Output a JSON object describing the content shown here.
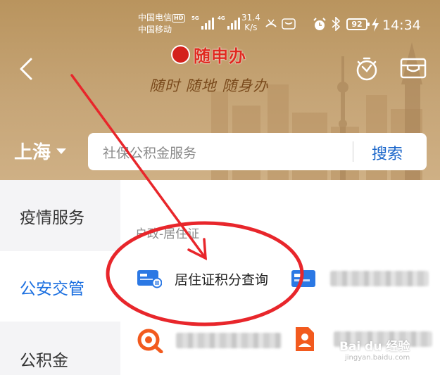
{
  "status_bar": {
    "carrier_1": "中国电信",
    "hd_badge": "HD",
    "carrier_2": "中国移动",
    "signal_1_tag": "5G",
    "signal_2_tag": "4G",
    "net_speed_value": "31.4",
    "net_speed_unit": "K/s",
    "battery": "92",
    "time": "14:34"
  },
  "header": {
    "app_title": "随申办",
    "slogan": "随时 随地 随身办",
    "city": "上海",
    "search": {
      "placeholder": "社保公积金服务",
      "button_label": "搜索"
    }
  },
  "sidebar": {
    "items": [
      {
        "label": "疫情服务",
        "active": false
      },
      {
        "label": "公安交管",
        "active": true
      },
      {
        "label": "公积金",
        "active": false
      }
    ]
  },
  "main": {
    "section_title": "户政-居住证",
    "services": [
      {
        "label": "居住证积分查询",
        "icon": "residence-card-icon"
      },
      {
        "label": "",
        "icon": "residence-card-icon",
        "blurred": true
      },
      {
        "label": "",
        "icon": "search-magnifier-icon",
        "blurred": true
      },
      {
        "label": "",
        "icon": "person-document-icon",
        "blurred": true
      }
    ]
  },
  "colors": {
    "header_bg": "#c4a270",
    "accent_blue": "#1b6fe0",
    "brand_red": "#e02a20",
    "annotation_red": "#e8262b",
    "icon_orange": "#f25a1e"
  },
  "watermark": {
    "brand": "Bai du 经验",
    "url": "jingyan.baidu.com"
  }
}
